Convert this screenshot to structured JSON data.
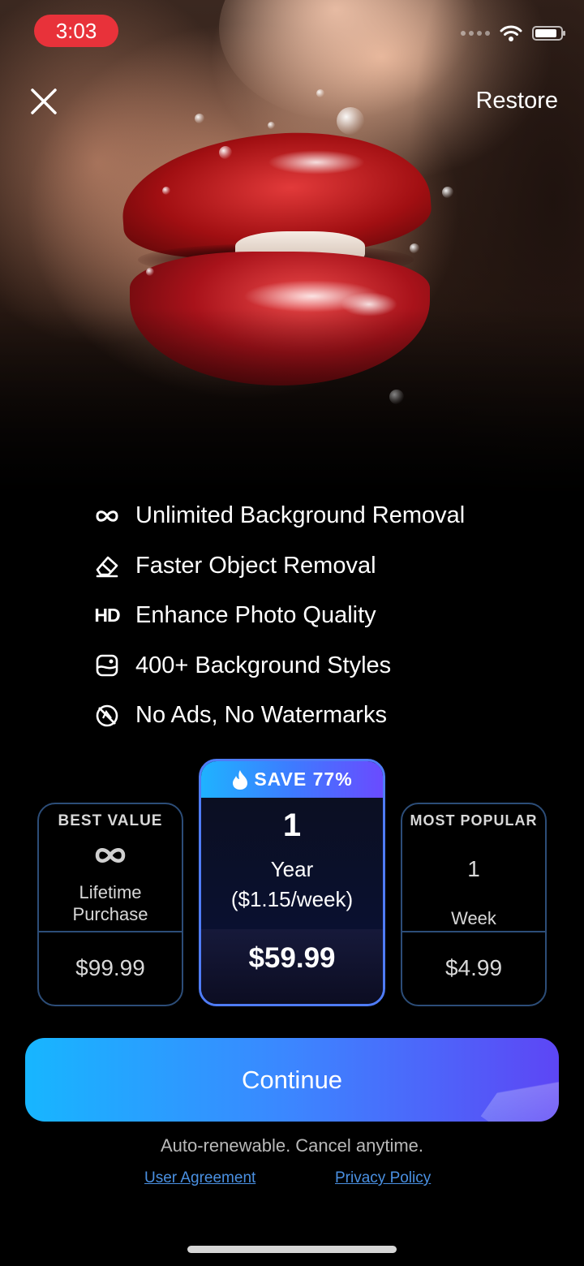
{
  "status_bar": {
    "time": "3:03",
    "icons": [
      "signal-dots",
      "wifi-icon",
      "battery-icon"
    ]
  },
  "header": {
    "close_icon": "close-icon",
    "restore_label": "Restore"
  },
  "features": [
    {
      "icon": "infinity-icon",
      "label": "Unlimited Background Removal"
    },
    {
      "icon": "eraser-icon",
      "label": "Faster Object Removal"
    },
    {
      "icon": "hd-icon",
      "label": "Enhance Photo Quality"
    },
    {
      "icon": "image-style-icon",
      "label": "400+ Background Styles"
    },
    {
      "icon": "no-ads-icon",
      "label": "No Ads, No Watermarks"
    }
  ],
  "hd_icon_text": "HD",
  "plans": {
    "lifetime": {
      "badge": "BEST VALUE",
      "icon": "infinity-icon",
      "line1": "Lifetime",
      "line2": "Purchase",
      "price": "$99.99"
    },
    "yearly": {
      "banner": "SAVE 77%",
      "banner_icon": "flame-icon",
      "count": "1",
      "unit": "Year",
      "per_week": "($1.15/week)",
      "price": "$59.99",
      "selected": true
    },
    "weekly": {
      "badge": "MOST POPULAR",
      "count": "1",
      "unit": "Week",
      "price": "$4.99"
    }
  },
  "continue_label": "Continue",
  "footer": {
    "note": "Auto-renewable. Cancel anytime.",
    "user_agreement": "User Agreement",
    "privacy_policy": "Privacy Policy"
  },
  "colors": {
    "accent_start": "#17b6ff",
    "accent_end": "#5d46f5",
    "status_pill": "#e8323a",
    "plan_border": "#2c4d78",
    "link": "#4a90e2"
  }
}
